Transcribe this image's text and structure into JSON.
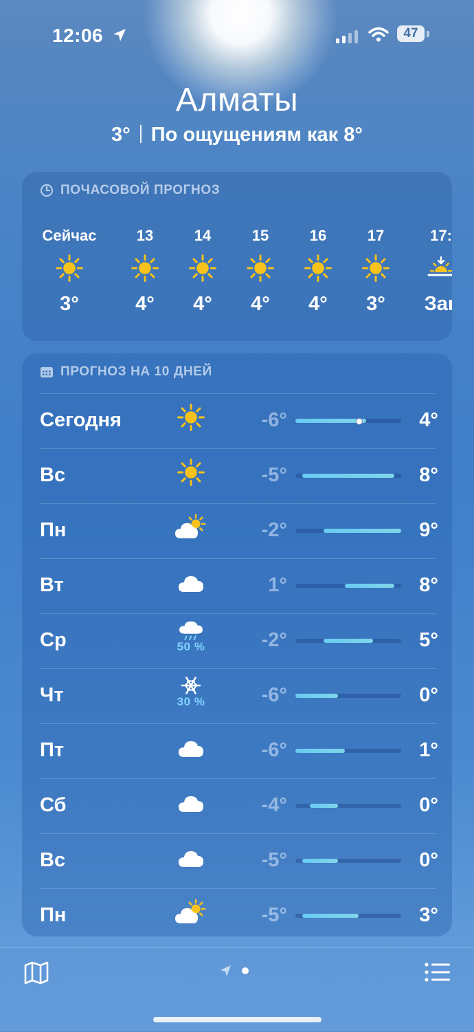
{
  "status_bar": {
    "time": "12:06",
    "battery": "47"
  },
  "header": {
    "city": "Алматы",
    "temp": "3°",
    "feels_like": "По ощущениям как 8°"
  },
  "hourly": {
    "title": "ПОЧАСОВОЙ ПРОГНОЗ",
    "items": [
      {
        "label": "Сейчас",
        "icon": "sun-icon",
        "temp": "3°"
      },
      {
        "label": "13",
        "icon": "sun-icon",
        "temp": "4°"
      },
      {
        "label": "14",
        "icon": "sun-icon",
        "temp": "4°"
      },
      {
        "label": "15",
        "icon": "sun-icon",
        "temp": "4°"
      },
      {
        "label": "16",
        "icon": "sun-icon",
        "temp": "4°"
      },
      {
        "label": "17",
        "icon": "sun-icon",
        "temp": "3°"
      },
      {
        "label": "17:",
        "icon": "sunset-icon",
        "temp": "Зак"
      }
    ]
  },
  "daily": {
    "title": "ПРОГНОЗ НА 10 ДНЕЙ",
    "range_min": -6,
    "range_max": 9,
    "current_temp": 3,
    "rows": [
      {
        "day": "Сегодня",
        "icon": "sun-icon",
        "precip": "",
        "low": "-6°",
        "high": "4°",
        "low_val": -6,
        "high_val": 4
      },
      {
        "day": "Вс",
        "icon": "sun-icon",
        "precip": "",
        "low": "-5°",
        "high": "8°",
        "low_val": -5,
        "high_val": 8
      },
      {
        "day": "Пн",
        "icon": "partly-cloudy-icon",
        "precip": "",
        "low": "-2°",
        "high": "9°",
        "low_val": -2,
        "high_val": 9
      },
      {
        "day": "Вт",
        "icon": "cloud-icon",
        "precip": "",
        "low": "1°",
        "high": "8°",
        "low_val": 1,
        "high_val": 8
      },
      {
        "day": "Ср",
        "icon": "rain-icon",
        "precip": "50 %",
        "low": "-2°",
        "high": "5°",
        "low_val": -2,
        "high_val": 5
      },
      {
        "day": "Чт",
        "icon": "snowflake-icon",
        "precip": "30 %",
        "low": "-6°",
        "high": "0°",
        "low_val": -6,
        "high_val": 0
      },
      {
        "day": "Пт",
        "icon": "cloud-icon",
        "precip": "",
        "low": "-6°",
        "high": "1°",
        "low_val": -6,
        "high_val": 1
      },
      {
        "day": "Сб",
        "icon": "cloud-icon",
        "precip": "",
        "low": "-4°",
        "high": "0°",
        "low_val": -4,
        "high_val": 0
      },
      {
        "day": "Вс",
        "icon": "cloud-icon",
        "precip": "",
        "low": "-5°",
        "high": "0°",
        "low_val": -5,
        "high_val": 0
      },
      {
        "day": "Пн",
        "icon": "partly-cloudy-icon",
        "precip": "",
        "low": "-5°",
        "high": "3°",
        "low_val": -5,
        "high_val": 3
      }
    ]
  },
  "colors": {
    "sun": "#f7c21b",
    "precip": "#7fd3ff",
    "bar": "#69cbf2"
  }
}
